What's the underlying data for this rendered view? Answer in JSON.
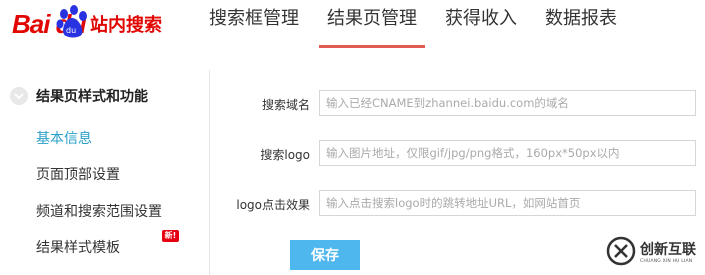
{
  "header": {
    "logo": {
      "brand": "Bai du",
      "sub": "站内搜索"
    },
    "nav": [
      "搜索框管理",
      "结果页管理",
      "获得收入",
      "数据报表"
    ],
    "active_nav": "结果页管理"
  },
  "sidebar": {
    "section_title": "结果页样式和功能",
    "items": [
      "基本信息",
      "页面顶部设置",
      "频道和搜索范围设置",
      "结果样式模板"
    ],
    "active_item": "基本信息",
    "new_badge": "新!"
  },
  "form": {
    "fields": [
      {
        "label": "搜索域名",
        "value": "",
        "placeholder": "输入已经CNAME到zhannei.baidu.com的域名"
      },
      {
        "label": "搜索logo",
        "value": "",
        "placeholder": "输入图片地址，仅限gif/jpg/png格式，160px*50px以内"
      },
      {
        "label": "logo点击效果",
        "value": "",
        "placeholder": "输入点击搜索logo时的跳转地址URL，如网站首页"
      }
    ],
    "save_label": "保存"
  },
  "watermark": {
    "text": "创新互联",
    "sub": "CHUANG XIN HU LIAN"
  },
  "colors": {
    "brand_red": "#e10601",
    "nav_active": "#e05a50",
    "link_active": "#2aa0c9",
    "save_button": "#4eb7ee"
  }
}
